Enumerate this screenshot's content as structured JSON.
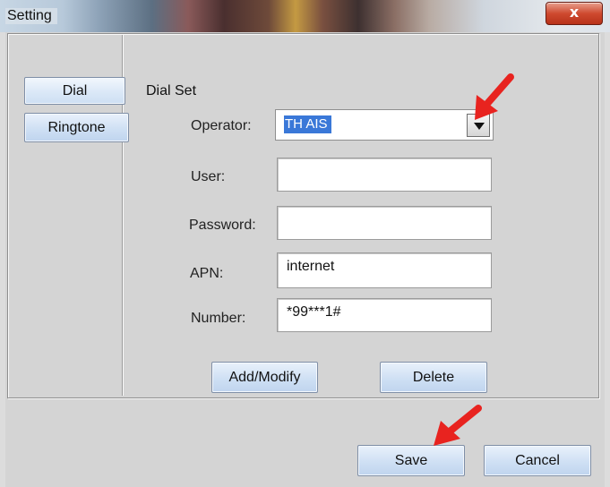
{
  "window": {
    "title": "Setting",
    "close_glyph": "x"
  },
  "nav": {
    "items": [
      {
        "label": "Dial",
        "selected": true
      },
      {
        "label": "Ringtone",
        "selected": false
      }
    ]
  },
  "dial_set": {
    "group_label": "Dial Set",
    "operator": {
      "label": "Operator:",
      "value": "TH AIS"
    },
    "user": {
      "label": "User:",
      "value": ""
    },
    "password": {
      "label": "Password:",
      "value": ""
    },
    "apn": {
      "label": "APN:",
      "value": "internet"
    },
    "number": {
      "label": "Number:",
      "value": "*99***1#"
    },
    "add_modify_label": "Add/Modify",
    "delete_label": "Delete"
  },
  "footer": {
    "save_label": "Save",
    "cancel_label": "Cancel"
  },
  "annotations": {
    "arrow_color": "#e8231f",
    "icon": "red-arrow-icon"
  },
  "colors": {
    "button_face": "#cfe0f4",
    "selection": "#3a78d8",
    "close_button": "#cf4a30"
  }
}
